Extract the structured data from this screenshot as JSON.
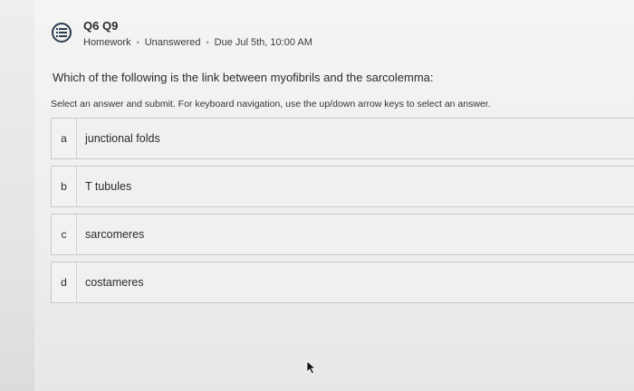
{
  "question": {
    "title": "Q6 Q9",
    "type": "Homework",
    "status": "Unanswered",
    "due": "Due Jul 5th, 10:00 AM",
    "separator": "•",
    "prompt": "Which of the following is the link between myofibrils and the sarcolemma:",
    "instructions": "Select an answer and submit. For keyboard navigation, use the up/down arrow keys to select an answer."
  },
  "choices": [
    {
      "letter": "a",
      "label": "junctional folds"
    },
    {
      "letter": "b",
      "label": "T tubules"
    },
    {
      "letter": "c",
      "label": "sarcomeres"
    },
    {
      "letter": "d",
      "label": "costameres"
    }
  ],
  "icons": {
    "question_icon": "question-list-icon",
    "cursor": "mouse-pointer-icon"
  },
  "colors": {
    "icon_stroke": "#2c3e50",
    "text": "#2b2b2b"
  }
}
